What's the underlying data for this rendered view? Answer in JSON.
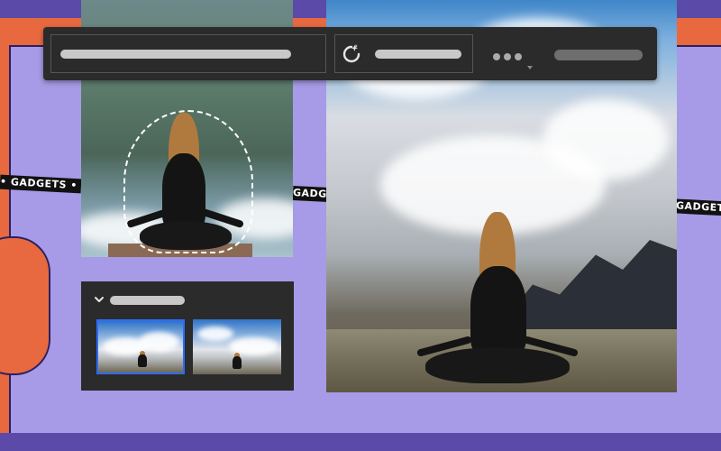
{
  "ticker": {
    "text_a": "• GADGETS • G",
    "text_b": "GADGETS",
    "text_c": "GADGETS"
  },
  "toolbar": {
    "magic_icon": "magic-refresh-icon",
    "more_icon": "more-dots-icon"
  },
  "panel": {
    "chevron_icon": "chevron-down-icon"
  },
  "colors": {
    "orange": "#e8693f",
    "lavender": "#a79ae6",
    "purple": "#5b4aa8",
    "toolbar_bg": "#2b2b2b",
    "selection_blue": "#2e6bff"
  }
}
